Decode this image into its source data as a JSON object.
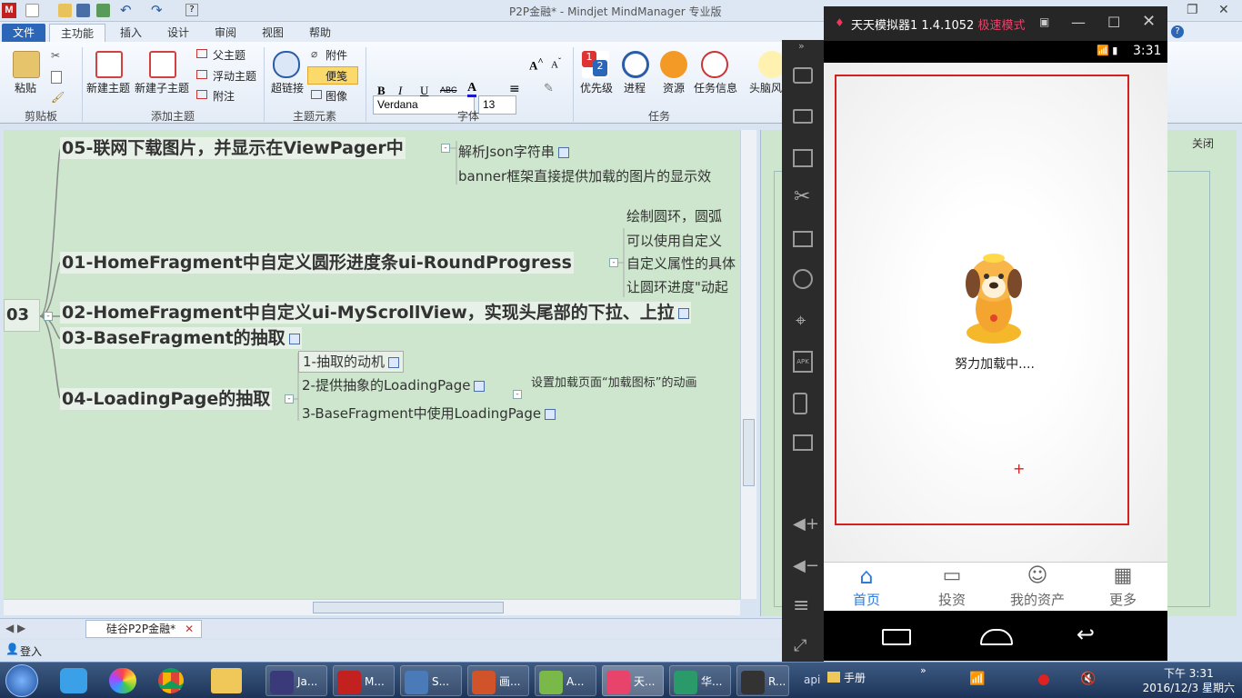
{
  "mindjet": {
    "title": "P2P金融* - Mindjet MindManager 专业版",
    "menu": [
      "文件",
      "主功能",
      "插入",
      "设计",
      "审阅",
      "视图",
      "帮助"
    ],
    "ribbon": {
      "paste": "粘贴",
      "clipboard_group": "剪贴板",
      "new_topic": "新建主题",
      "new_subtopic": "新建子主题",
      "parent_topic": "父主题",
      "floating_topic": "浮动主题",
      "callout": "附注",
      "add_topic_group": "添加主题",
      "hyperlink": "超链接",
      "attachment": "附件",
      "note": "便笺",
      "image": "图像",
      "topic_elements_group": "主题元素",
      "font_name": "Verdana",
      "font_size": "13",
      "font_group": "字体",
      "bold": "B",
      "italic": "I",
      "underline": "U",
      "strike": "ABC",
      "priority": "优先级",
      "progress": "进程",
      "resource": "资源",
      "task_info": "任务信息",
      "task_group": "任务",
      "brainstorm": "头脑风"
    },
    "map": {
      "topic05_num": "05-",
      "topic05_text": "联网下载图片，并显示在ViewPager中",
      "topic05_sub1": "解析Json字符串",
      "topic05_sub2": "banner框架直接提供加载的图片的显示效",
      "topic01_num": "01-",
      "topic01_text": "HomeFragment中自定义圆形进度条ui-RoundProgress",
      "topic01_sub1": "绘制圆环，圆弧",
      "topic01_sub2": "可以使用自定义",
      "topic01_sub3": "自定义属性的具体",
      "topic01_sub4": "让圆环进度\"动起",
      "main_label": "03",
      "topic02_num": "02-",
      "topic02_text": "HomeFragment中自定义ui-MyScrollView，实现头尾部的下拉、上拉",
      "topic03_num": "03-",
      "topic03_text": "BaseFragment的抽取",
      "topic04_num": "04-",
      "topic04_text": "LoadingPage的抽取",
      "sub_a": "1-抽取的动机",
      "sub_b": "2-提供抽象的LoadingPage",
      "sub_b_note": "设置加载页面“加载图标”的动画",
      "sub_c": "3-BaseFragment中使用LoadingPage"
    },
    "doc_tab": "硅谷P2P金融*",
    "status_login": "登入",
    "close_label": "关闭"
  },
  "emulator": {
    "title": "天天模拟器1 1.4.1052",
    "mode": "极速模式",
    "time": "3:31",
    "loading_text": "努力加载中....",
    "nav": [
      "首页",
      "投资",
      "我的资产",
      "更多"
    ]
  },
  "taskbar": {
    "apps": [
      "Ja...",
      "M...",
      "S...",
      "画...",
      "A...",
      "天...",
      "华...",
      "R..."
    ],
    "tray_api": "api",
    "tray_folder": "手册",
    "clock_time": "下午 3:31",
    "clock_date": "2016/12/3 星期六"
  },
  "colors": {
    "accent": "#2b66b8",
    "map_bg": "#cde6cd",
    "emu_red": "#d52020",
    "nav_active": "#2f7bd8"
  }
}
